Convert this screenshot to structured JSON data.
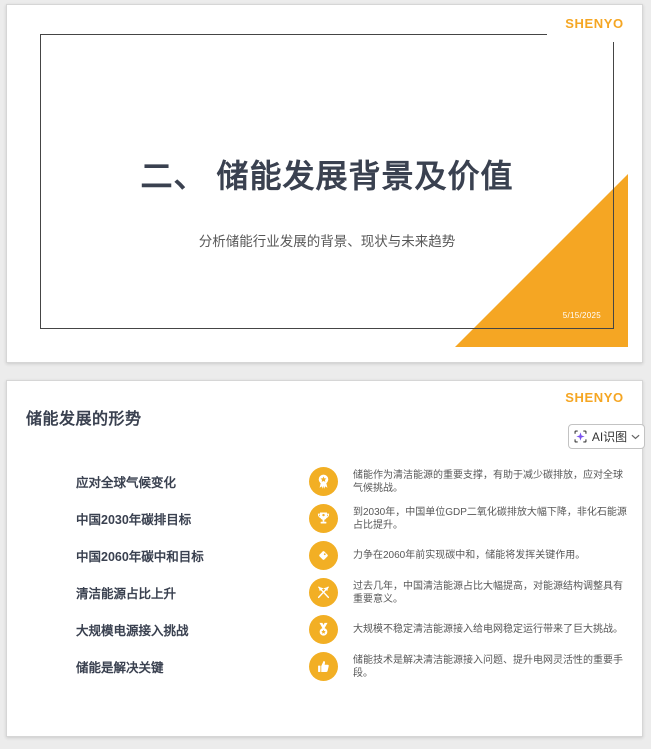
{
  "colors": {
    "accent": "#F5A623",
    "icon_circle": "#F2AF24",
    "title_text": "#3A4150",
    "body_text": "#575757",
    "sparkle": "#7B52F0"
  },
  "slide1": {
    "logo": "SHENYO",
    "title": "二、 储能发展背景及价值",
    "subtitle": "分析储能行业发展的背景、现状与未来趋势",
    "date": "5/15/2025"
  },
  "slide2": {
    "logo": "SHENYO",
    "title": "储能发展的形势",
    "ai_button": {
      "label": "AI识图",
      "icon": "sparkle-scan-icon"
    },
    "items": [
      {
        "label": "应对全球气候变化",
        "icon": "award-ribbon-icon",
        "desc": "储能作为清洁能源的重要支撑，有助于减少碳排放，应对全球气候挑战。"
      },
      {
        "label": "中国2030年碳排目标",
        "icon": "trophy-icon",
        "desc": "到2030年，中国单位GDP二氧化碳排放大幅下降，非化石能源占比提升。"
      },
      {
        "label": "中国2060年碳中和目标",
        "icon": "tag-icon",
        "desc": "力争在2060年前实现碳中和，储能将发挥关键作用。"
      },
      {
        "label": "清洁能源占比上升",
        "icon": "crossed-flags-icon",
        "desc": "过去几年，中国清洁能源占比大幅提高，对能源结构调整具有重要意义。"
      },
      {
        "label": "大规模电源接入挑战",
        "icon": "medal-star-icon",
        "desc": "大规模不稳定清洁能源接入给电网稳定运行带来了巨大挑战。"
      },
      {
        "label": "储能是解决关键",
        "icon": "thumbs-up-icon",
        "desc": "储能技术是解决清洁能源接入问题、提升电网灵活性的重要手段。"
      }
    ]
  }
}
